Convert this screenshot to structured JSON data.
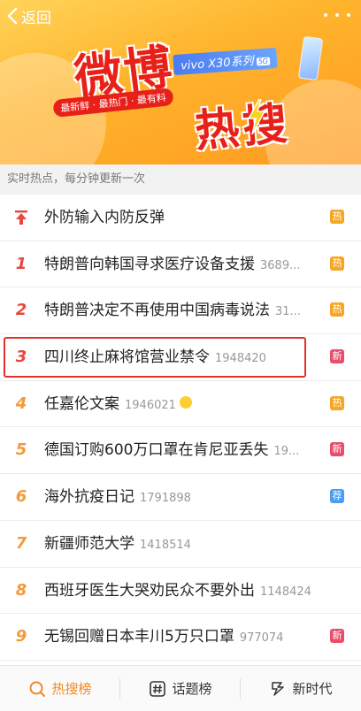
{
  "header": {
    "back_label": "返回",
    "title_main": "微博",
    "title_sub": "热搜",
    "tagline": "最新鲜 · 最热门 · 最有料",
    "sponsor_text": "vivo X30系列",
    "sponsor_badge": "5G"
  },
  "subheader": "实时热点，每分钟更新一次",
  "list": [
    {
      "rank": "",
      "rank_icon": "pin-up-icon",
      "title": "外防输入内防反弹",
      "count": "",
      "tag": "热",
      "tag_color": "#f5a623"
    },
    {
      "rank": "1",
      "title": "特朗普向韩国寻求医疗设备支援",
      "count": "3689...",
      "tag": "热",
      "tag_color": "#f5a623"
    },
    {
      "rank": "2",
      "title": "特朗普决定不再使用中国病毒说法",
      "count": "31...",
      "tag": "热",
      "tag_color": "#f5a623"
    },
    {
      "rank": "3",
      "title": "四川终止麻将馆营业禁令",
      "count": "1948420",
      "tag": "新",
      "tag_color": "#ea4d6b",
      "highlighted": true
    },
    {
      "rank": "4",
      "title": "任嘉伦文案",
      "count": "1946021",
      "emoji": "laugh-emoji",
      "tag": "热",
      "tag_color": "#f5a623"
    },
    {
      "rank": "5",
      "title": "德国订购600万口罩在肯尼亚丢失",
      "count": "19...",
      "tag": "新",
      "tag_color": "#ea4d6b"
    },
    {
      "rank": "6",
      "title": "海外抗疫日记",
      "count": "1791898",
      "tag": "荐",
      "tag_color": "#4a9df2"
    },
    {
      "rank": "7",
      "title": "新疆师范大学",
      "count": "1418514",
      "tag": "",
      "tag_color": ""
    },
    {
      "rank": "8",
      "title": "西班牙医生大哭劝民众不要外出",
      "count": "1148424",
      "emoji": "cry-emoji",
      "tag": "",
      "tag_color": ""
    },
    {
      "rank": "9",
      "title": "无锡回赠日本丰川5万只口罩",
      "count": "977074",
      "tag": "新",
      "tag_color": "#ea4d6b"
    }
  ],
  "bottom_nav": [
    {
      "label": "热搜榜",
      "icon": "search-icon",
      "active": true
    },
    {
      "label": "话题榜",
      "icon": "hashtag-icon",
      "active": false
    },
    {
      "label": "新时代",
      "icon": "new-era-icon",
      "active": false
    }
  ],
  "colors": {
    "accent": "#f08a24",
    "rank_top3": "#e8473c",
    "rank_other": "#f39a3a",
    "highlight_box": "#e0312b"
  }
}
